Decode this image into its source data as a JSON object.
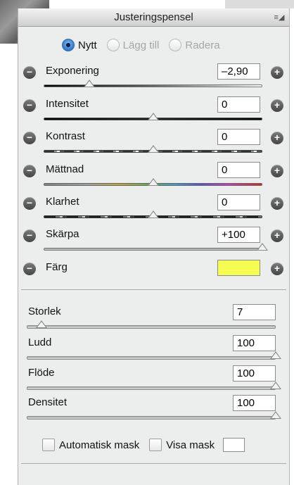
{
  "panel": {
    "title": "Justeringspensel"
  },
  "modes": [
    {
      "label": "Nytt",
      "selected": true,
      "enabled": true
    },
    {
      "label": "Lägg till",
      "selected": false,
      "enabled": false
    },
    {
      "label": "Radera",
      "selected": false,
      "enabled": false
    }
  ],
  "adjustments": {
    "exponering": {
      "label": "Exponering",
      "value": "–2,90",
      "slider_fraction": 0.21
    },
    "intensitet": {
      "label": "Intensitet",
      "value": "0",
      "slider_fraction": 0.5
    },
    "kontrast": {
      "label": "Kontrast",
      "value": "0",
      "slider_fraction": 0.5
    },
    "mattnad": {
      "label": "Mättnad",
      "value": "0",
      "slider_fraction": 0.5
    },
    "klarhet": {
      "label": "Klarhet",
      "value": "0",
      "slider_fraction": 0.5
    },
    "skarpa": {
      "label": "Skärpa",
      "value": "+100",
      "slider_fraction": 1.0
    },
    "farg": {
      "label": "Färg",
      "color": "#f5fd52"
    }
  },
  "brush": {
    "storlek": {
      "label": "Storlek",
      "value": "7",
      "slider_fraction": 0.06
    },
    "ludd": {
      "label": "Ludd",
      "value": "100",
      "slider_fraction": 1.0
    },
    "flode": {
      "label": "Flöde",
      "value": "100",
      "slider_fraction": 1.0
    },
    "densitet": {
      "label": "Densitet",
      "value": "100",
      "slider_fraction": 1.0
    }
  },
  "options": {
    "auto_mask_label": "Automatisk mask",
    "auto_mask_checked": false,
    "show_mask_label": "Visa mask",
    "show_mask_checked": false,
    "mask_color": "#ffffff"
  }
}
